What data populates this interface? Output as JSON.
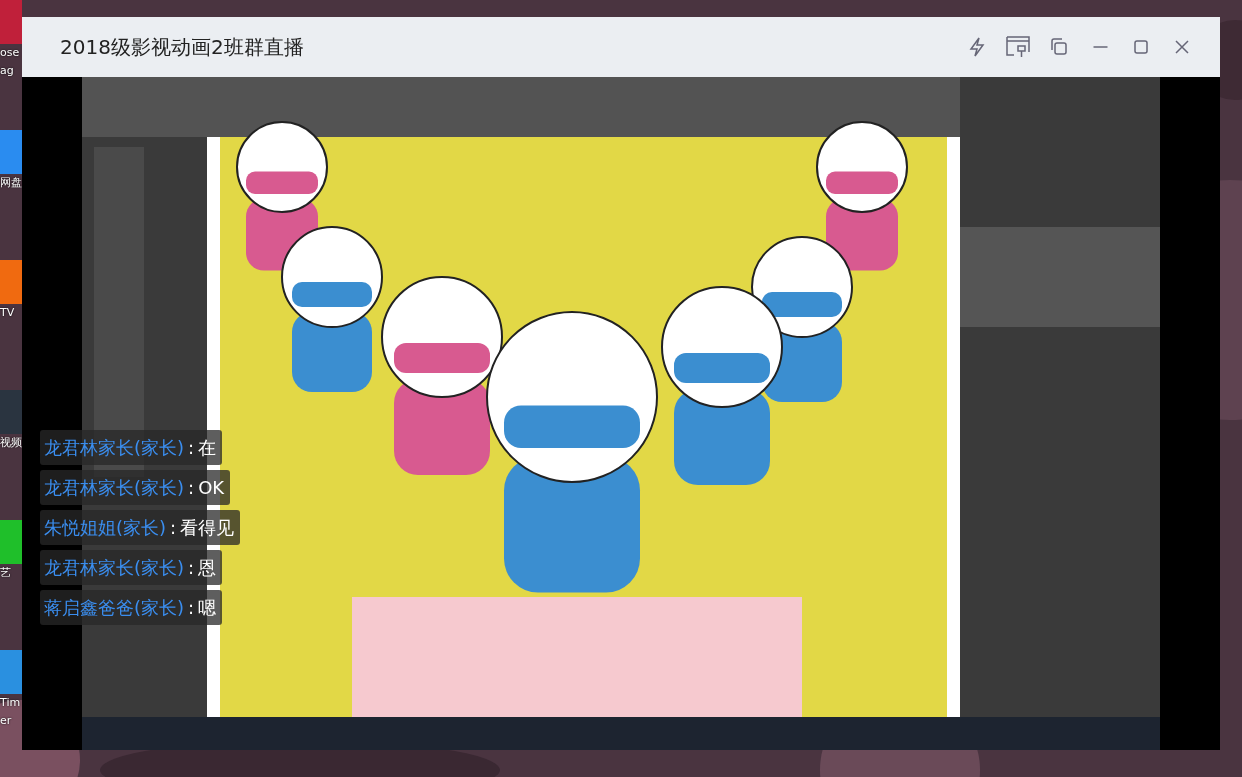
{
  "desktop": {
    "icons": [
      {
        "lines": [
          "ose",
          "ag"
        ],
        "color": "#c0203a"
      },
      {
        "lines": [
          "网盘"
        ],
        "color": "#2a8cf0"
      },
      {
        "lines": [
          "TV"
        ],
        "color": "#f06a10"
      },
      {
        "lines": [
          "视频"
        ],
        "color": "#2a3440"
      },
      {
        "lines": [
          "艺"
        ],
        "color": "#1fbf2a"
      },
      {
        "lines": [
          "Tim",
          "er"
        ],
        "color": "#2a90e0"
      }
    ]
  },
  "window": {
    "title": "2018级影视动画2班群直播"
  },
  "chat": [
    {
      "user": "龙君林家长(家长)",
      "sep": ":",
      "text": "在"
    },
    {
      "user": "龙君林家长(家长)",
      "sep": ":",
      "text": "OK"
    },
    {
      "user": "朱悦姐姐(家长)",
      "sep": ":",
      "text": "看得见"
    },
    {
      "user": "龙君林家长(家长)",
      "sep": ":",
      "text": "恩"
    },
    {
      "user": "蒋启鑫爸爸(家长)",
      "sep": ":",
      "text": "嗯"
    }
  ]
}
